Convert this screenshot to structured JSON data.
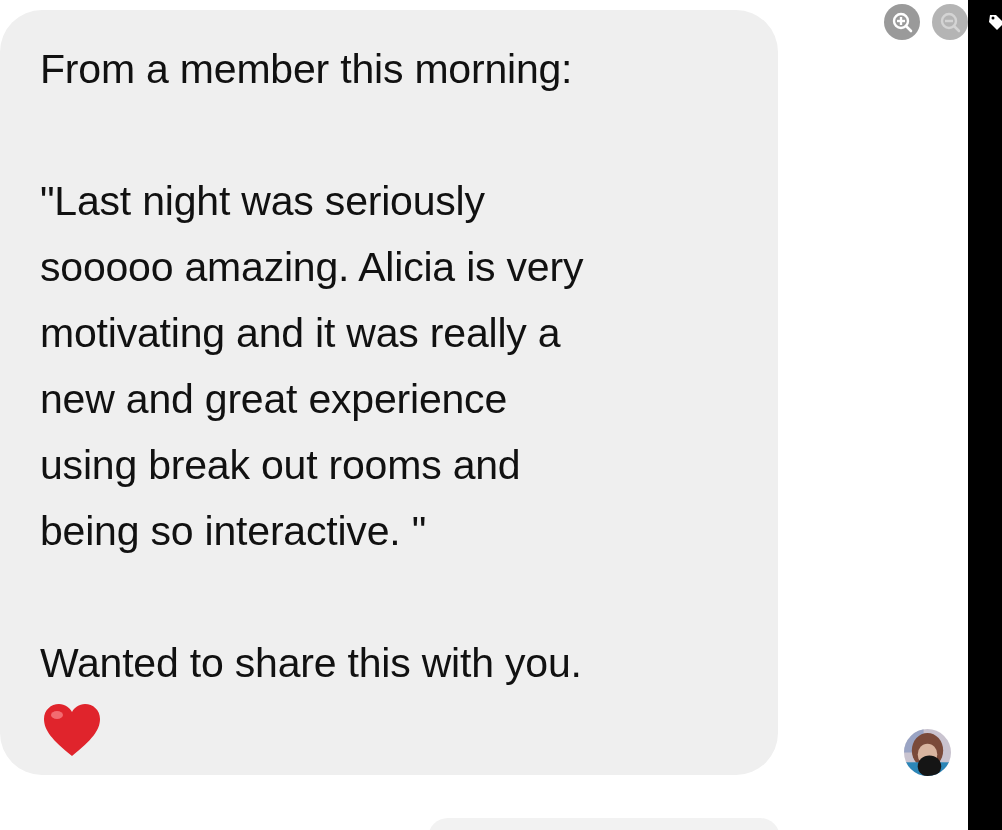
{
  "message": {
    "paragraphs": [
      {
        "lines": [
          "From a member this morning:"
        ]
      },
      {
        "lines": [
          "\"Last night was seriously",
          "sooooo amazing. Alicia is very",
          "motivating and it was really a",
          "new and great experience",
          "using break out rooms and",
          "being so interactive. \""
        ]
      },
      {
        "lines": [
          "Wanted to share this with you."
        ]
      }
    ]
  },
  "zoom_controls": [
    {
      "kind": "zoom-in",
      "disabled": false
    },
    {
      "kind": "zoom-out",
      "disabled": true
    }
  ]
}
